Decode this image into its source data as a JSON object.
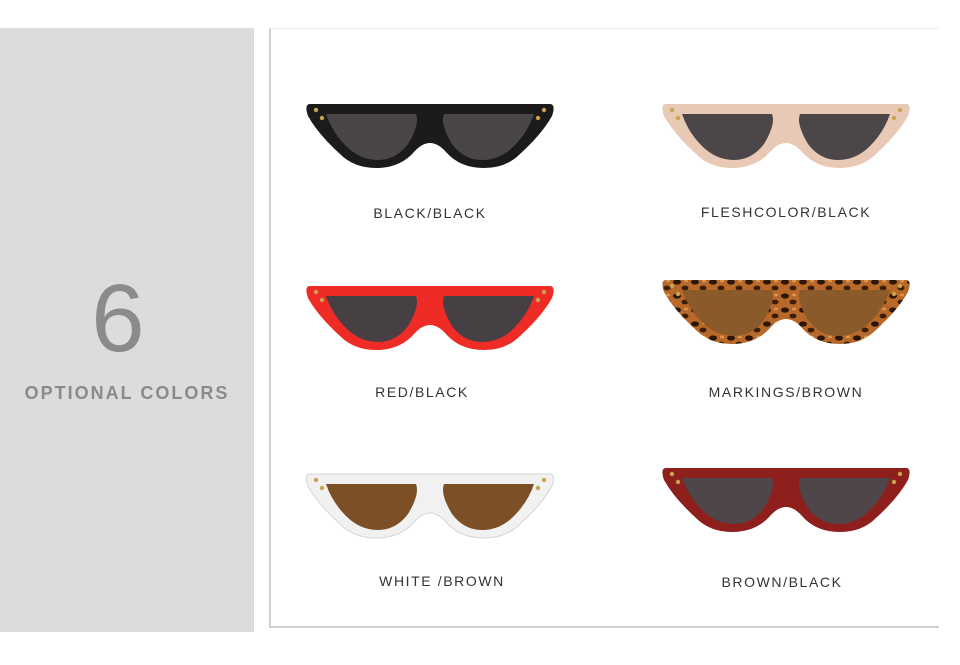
{
  "panel": {
    "count": "6",
    "title": "OPTIONAL COLORS"
  },
  "variants": [
    {
      "label": "BLACK/BLACK",
      "frame": "#1b1b1b",
      "lens": "#4a4548",
      "temple": "#2a2626",
      "pattern": "solid"
    },
    {
      "label": "FLESHCOLOR/BLACK",
      "frame": "#e8c9b6",
      "lens": "#4c4649",
      "temple": "#6d5b52",
      "pattern": "solid"
    },
    {
      "label": "RED/BLACK",
      "frame": "#ee2b24",
      "lens": "#463f44",
      "temple": "#5a4448",
      "pattern": "solid"
    },
    {
      "label": "MARKINGS/BROWN",
      "frame": "#b8692a",
      "lens": "#8b5a2b",
      "temple": "#7a4d22",
      "pattern": "leopard"
    },
    {
      "label": "WHITE /BROWN",
      "frame": "#f1f1f1",
      "lens": "#7c4f27",
      "temple": "#8e6a4a",
      "pattern": "solid"
    },
    {
      "label": "BROWN/BLACK",
      "frame": "#8e1f1c",
      "lens": "#4f4649",
      "temple": "#4a3434",
      "pattern": "solid"
    }
  ]
}
